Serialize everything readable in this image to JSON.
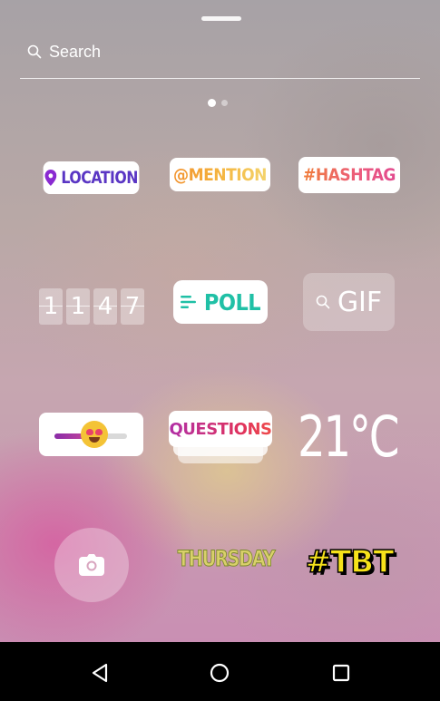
{
  "search": {
    "label": "Search"
  },
  "pager": {
    "pages": 2,
    "active": 1
  },
  "stickers": {
    "location": "LOCATION",
    "mention": "@MENTION",
    "hashtag": "#HASHTAG",
    "countdown_digits": [
      "1",
      "1",
      "4",
      "7"
    ],
    "poll": "POLL",
    "gif": "GIF",
    "questions": "QUESTIONS",
    "temperature": "21°C",
    "thursday": "THURSDAY",
    "tbt": "#TBT"
  },
  "colors": {
    "location": "#5a36c4",
    "poll": "#20c0a6",
    "tbt": "#f6e21a"
  },
  "icons": {
    "search": "search-icon",
    "location": "location-pin-icon",
    "poll": "poll-lines-icon",
    "gif": "search-icon",
    "camera": "camera-icon",
    "back": "back-triangle-icon",
    "home": "home-circle-icon",
    "recents": "recents-square-icon"
  }
}
